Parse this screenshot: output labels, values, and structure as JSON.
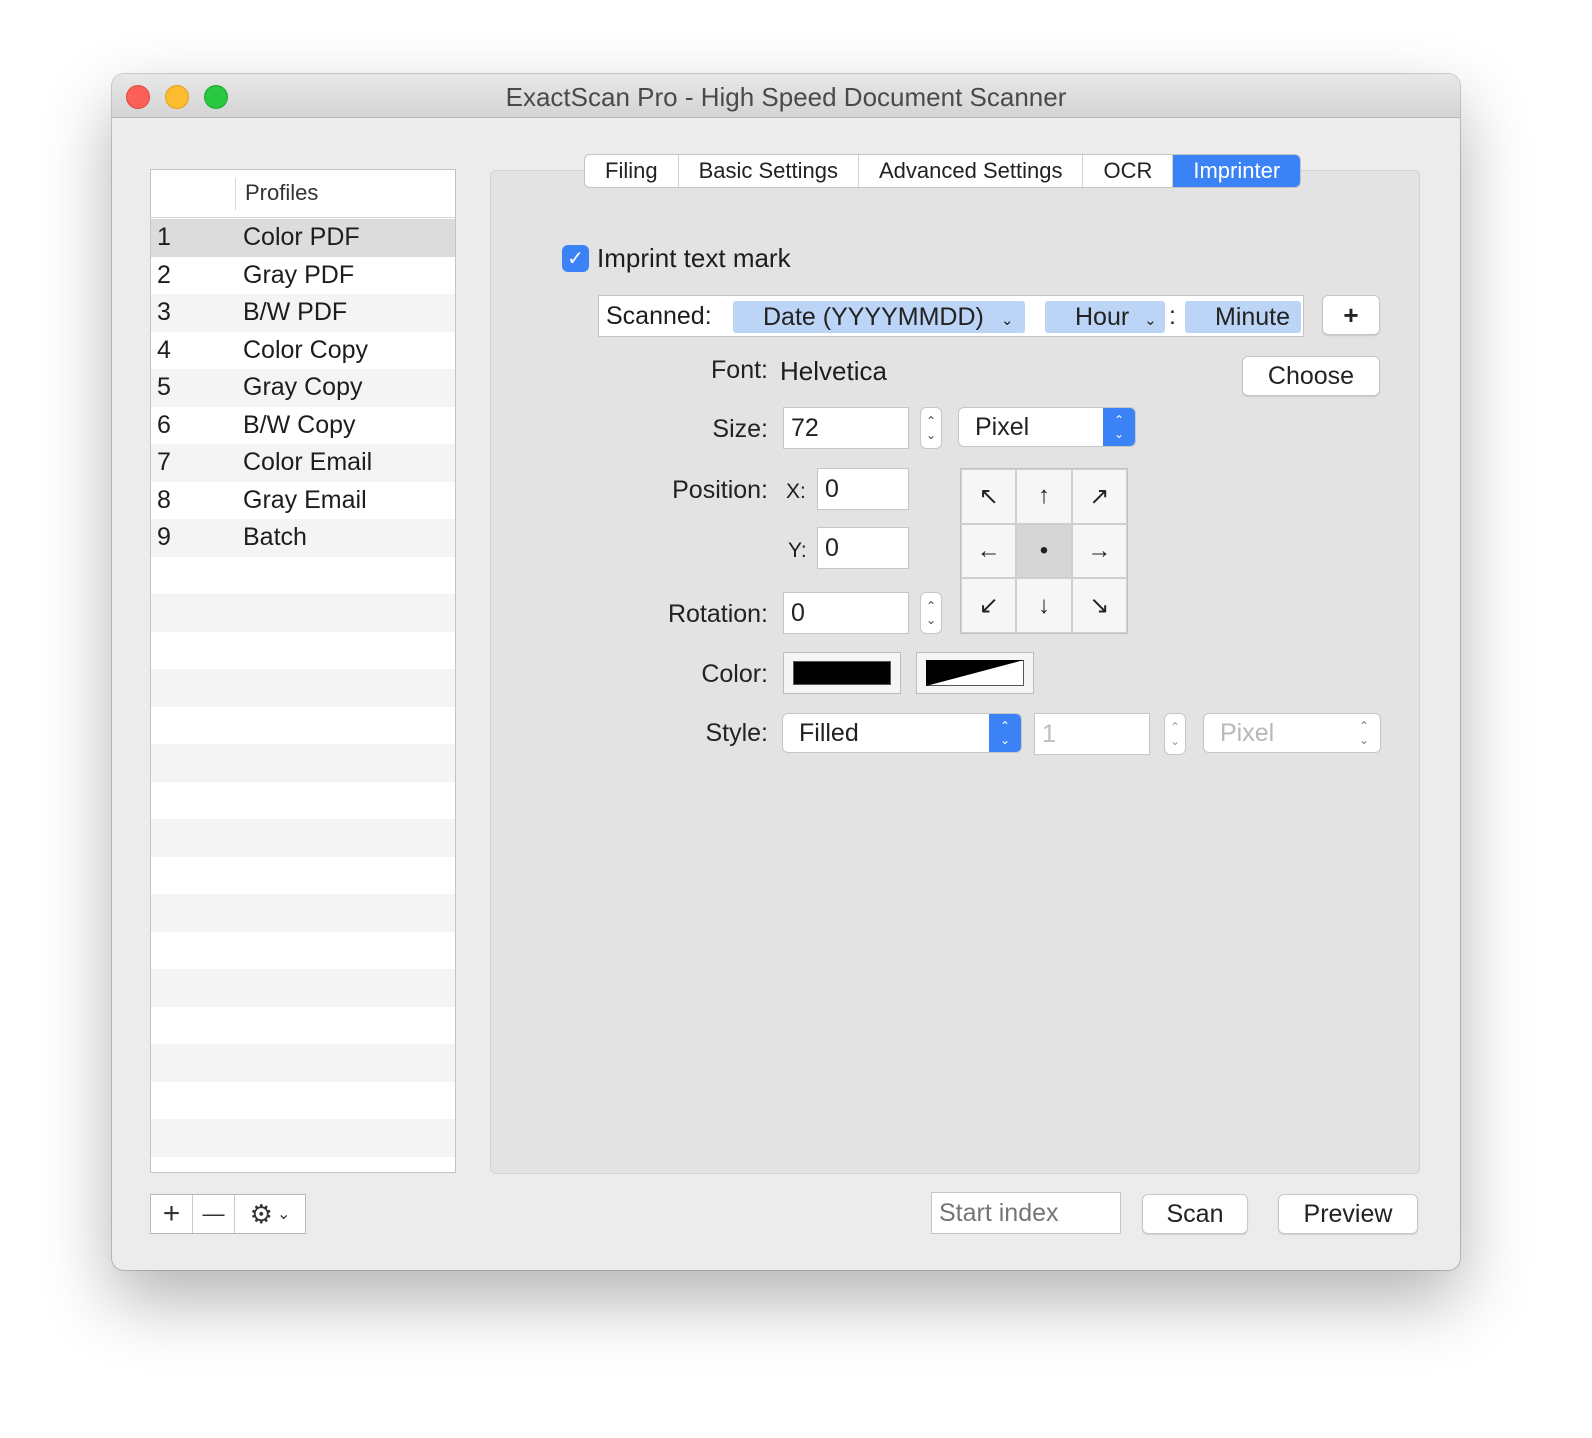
{
  "window": {
    "title": "ExactScan Pro - High Speed Document Scanner"
  },
  "profiles": {
    "header": "Profiles",
    "items": [
      {
        "num": "1",
        "name": "Color PDF"
      },
      {
        "num": "2",
        "name": "Gray PDF"
      },
      {
        "num": "3",
        "name": "B/W PDF"
      },
      {
        "num": "4",
        "name": "Color Copy"
      },
      {
        "num": "5",
        "name": "Gray Copy"
      },
      {
        "num": "6",
        "name": "B/W Copy"
      },
      {
        "num": "7",
        "name": "Color Email"
      },
      {
        "num": "8",
        "name": "Gray Email"
      },
      {
        "num": "9",
        "name": "Batch"
      }
    ],
    "selected_index": 0,
    "add_label": "+",
    "remove_label": "—",
    "gear_icon": "gear-icon",
    "gear_chevron": "⌄"
  },
  "tabs": [
    "Filing",
    "Basic Settings",
    "Advanced Settings",
    "OCR",
    "Imprinter"
  ],
  "active_tab": "Imprinter",
  "imprinter": {
    "checkbox_label": "Imprint text mark",
    "checkbox_checked": true,
    "tokens": {
      "prefix": "Scanned:",
      "date": "Date (YYYYMMDD)",
      "hour": "Hour",
      "separator": ":",
      "minute": "Minute",
      "chevron": "⌄"
    },
    "add_token_label": "+",
    "font_label": "Font:",
    "font_value": "Helvetica",
    "choose_label": "Choose",
    "size_label": "Size:",
    "size_value": "72",
    "size_unit": "Pixel",
    "position_label": "Position:",
    "x_label": "X:",
    "x_value": "0",
    "y_label": "Y:",
    "y_value": "0",
    "rotation_label": "Rotation:",
    "rotation_value": "0",
    "anchor_arrows": [
      "↖",
      "↑",
      "↗",
      "←",
      "•",
      "→",
      "↙",
      "↓",
      "↘"
    ],
    "color_label": "Color:",
    "style_label": "Style:",
    "style_value": "Filled",
    "stroke_value": "1",
    "stroke_unit": "Pixel"
  },
  "footer": {
    "start_index_placeholder": "Start index",
    "scan_label": "Scan",
    "preview_label": "Preview"
  },
  "colors": {
    "accent": "#3b82f6",
    "token_bg": "#bcd4f6",
    "close": "#fc5f57",
    "minimize": "#fdbc2e",
    "maximize": "#28c840"
  }
}
